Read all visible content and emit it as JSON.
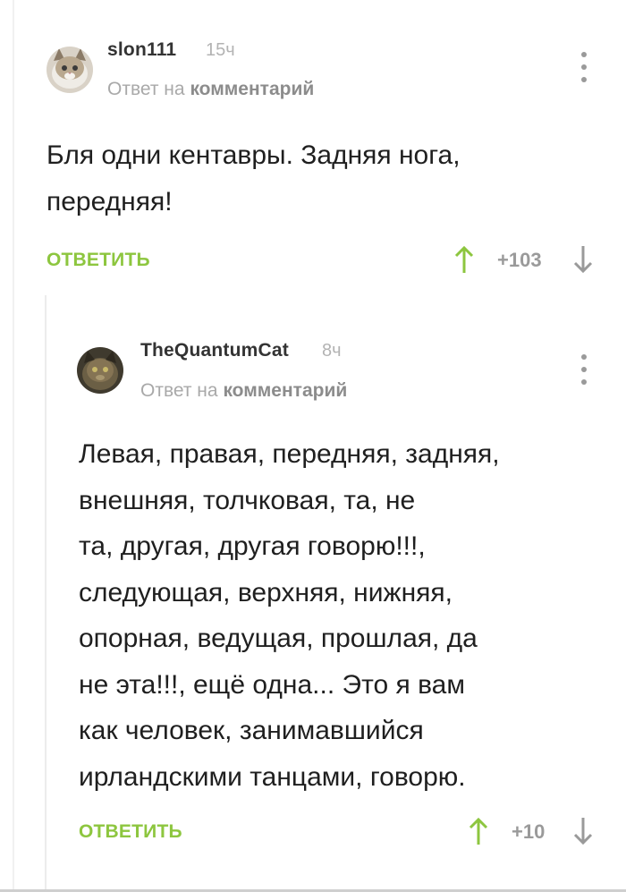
{
  "comments": [
    {
      "author": "slon111",
      "time": "15ч",
      "reply_prefix": "Ответ на",
      "reply_target": "комментарий",
      "text_lines": [
        "Бля одни кентавры. Задняя нога,",
        "передняя!"
      ],
      "reply_label": "ОТВЕТИТЬ",
      "score": "+103",
      "avatar": "cat-avatar",
      "colors": {
        "accent": "#8dc63f"
      }
    },
    {
      "author": "TheQuantumCat",
      "time": "8ч",
      "reply_prefix": "Ответ на",
      "reply_target": "комментарий",
      "text_lines": [
        "Левая, правая, передняя, задняя,",
        "внешняя, толчковая, та, не",
        "та, другая, другая говорю!!!,",
        "следующая, верхняя, нижняя,",
        "опорная, ведущая, прошлая, да",
        "не эта!!!, ещё одна... Это я вам",
        "как человек, занимавшийся",
        "ирландскими танцами, говорю."
      ],
      "reply_label": "ОТВЕТИТЬ",
      "score": "+10",
      "avatar": "dark-cat-avatar",
      "colors": {
        "accent": "#8dc63f"
      }
    }
  ],
  "icons": {
    "menu": "vertical-dots-icon",
    "upvote": "arrow-up-icon",
    "downvote": "arrow-down-icon"
  }
}
